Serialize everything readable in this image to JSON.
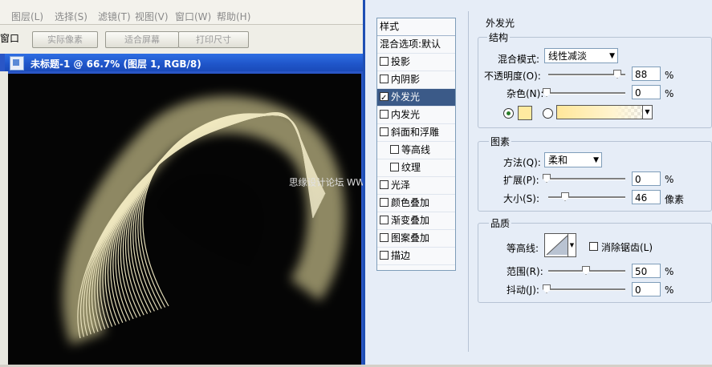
{
  "app": {
    "menu": [
      "图层(L)",
      "选择(S)",
      "滤镜(T)",
      "视图(V)",
      "窗口(W)",
      "帮助(H)"
    ],
    "window_label": "窗口",
    "options_buttons": [
      "实际像素",
      "适合屏幕",
      "打印尺寸"
    ]
  },
  "document": {
    "title": "未标题-1 @ 66.7% (图层 1, RGB/8)"
  },
  "watermark": "思缘设计论坛 WWW.MISSYUAN.COM",
  "styles_panel": {
    "header": "样式",
    "blend_default": "混合选项:默认",
    "items": [
      {
        "label": "投影",
        "checked": false
      },
      {
        "label": "内阴影",
        "checked": false
      },
      {
        "label": "外发光",
        "checked": true,
        "selected": true
      },
      {
        "label": "内发光",
        "checked": false
      },
      {
        "label": "斜面和浮雕",
        "checked": false
      },
      {
        "label": "等高线",
        "checked": false,
        "indent": true
      },
      {
        "label": "纹理",
        "checked": false,
        "indent": true
      },
      {
        "label": "光泽",
        "checked": false
      },
      {
        "label": "颜色叠加",
        "checked": false
      },
      {
        "label": "渐变叠加",
        "checked": false
      },
      {
        "label": "图案叠加",
        "checked": false
      },
      {
        "label": "描边",
        "checked": false
      }
    ]
  },
  "outer_glow": {
    "title": "外发光",
    "structure": {
      "label": "结构",
      "blend_mode_label": "混合模式:",
      "blend_mode_value": "线性减淡",
      "opacity_label": "不透明度(O):",
      "opacity_value": "88",
      "opacity_unit": "%",
      "noise_label": "杂色(N):",
      "noise_value": "0",
      "noise_unit": "%",
      "glow_color": "#ffeaa0"
    },
    "elements": {
      "label": "图素",
      "method_label": "方法(Q):",
      "method_value": "柔和",
      "spread_label": "扩展(P):",
      "spread_value": "0",
      "spread_unit": "%",
      "size_label": "大小(S):",
      "size_value": "46",
      "size_unit": "像素"
    },
    "quality": {
      "label": "品质",
      "contour_label": "等高线:",
      "antialias_label": "消除锯齿(L)",
      "range_label": "范围(R):",
      "range_value": "50",
      "range_unit": "%",
      "jitter_label": "抖动(J):",
      "jitter_value": "0",
      "jitter_unit": "%"
    }
  }
}
